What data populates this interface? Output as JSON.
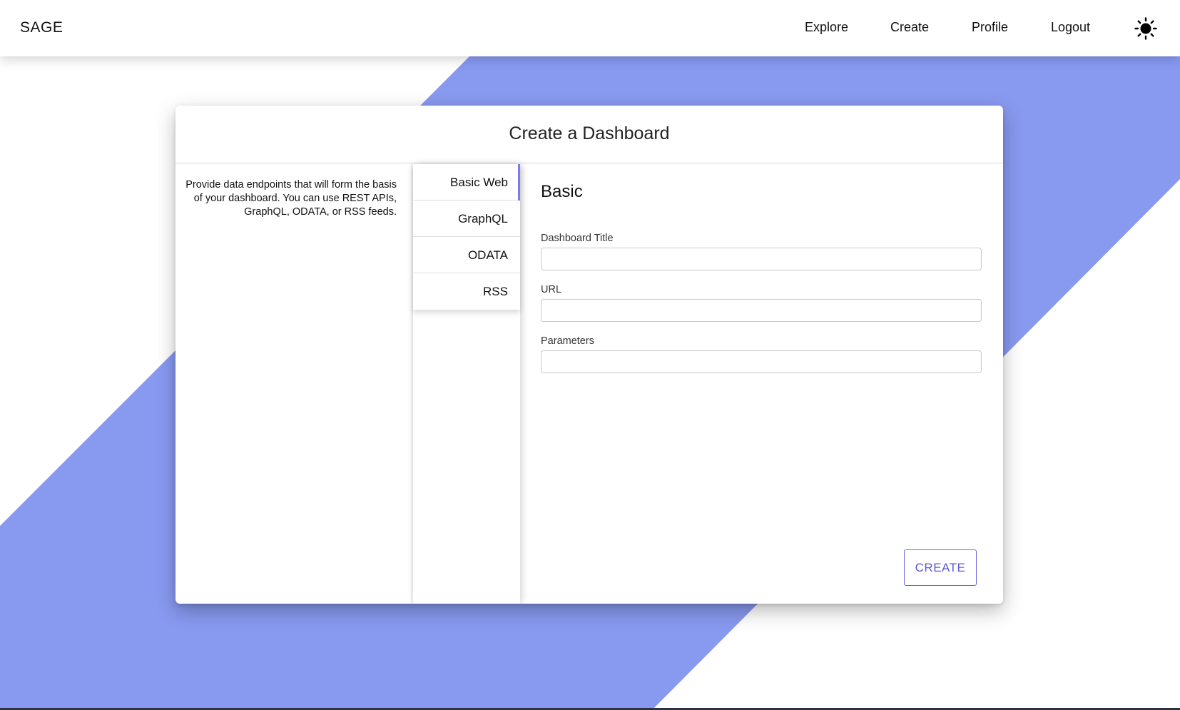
{
  "header": {
    "brand": "SAGE",
    "nav": {
      "explore": "Explore",
      "create": "Create",
      "profile": "Profile",
      "logout": "Logout"
    },
    "theme_toggle_icon": "sun-icon"
  },
  "card": {
    "title": "Create a Dashboard",
    "description": "Provide data endpoints that will form the basis of your dashboard. You can use REST APIs, GraphQL, ODATA, or RSS feeds.",
    "tabs": [
      {
        "label": "Basic Web",
        "active": true
      },
      {
        "label": "GraphQL",
        "active": false
      },
      {
        "label": "ODATA",
        "active": false
      },
      {
        "label": "RSS",
        "active": false
      }
    ],
    "form": {
      "section_title": "Basic",
      "dashboard_title_label": "Dashboard Title",
      "dashboard_title_value": "",
      "url_label": "URL",
      "url_value": "",
      "parameters_label": "Parameters",
      "parameters_value": "",
      "submit_label": "CREATE"
    }
  },
  "colors": {
    "background_stripe": "#8899f0",
    "accent": "#7d7bea",
    "button_text": "#5c59d0"
  }
}
